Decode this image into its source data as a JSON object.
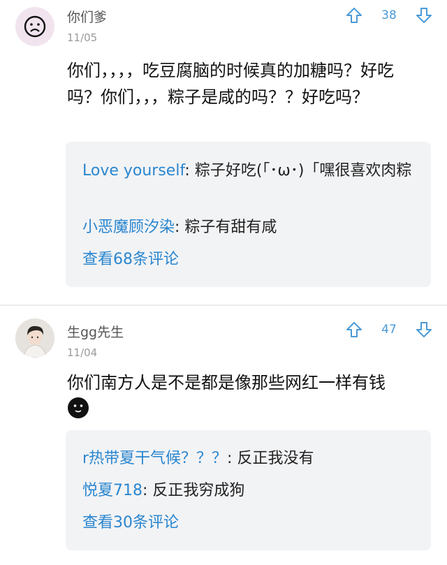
{
  "comments": [
    {
      "username": "你们爹",
      "date": "11/05",
      "votes": "38",
      "text": "你们，，，，吃豆腐脑的时候真的加糖吗？好吃吗？你们，，，粽子是咸的吗？？好吃吗？",
      "avatar_icon": "sad-face-icon",
      "replies": [
        {
          "name": "Love yourself",
          "sep": ": ",
          "text": "粽子好吃(「･ω･)「嘿很喜欢肉粽"
        },
        {
          "name": "小恶魔顾汐染",
          "sep": ": ",
          "text": "粽子有甜有咸"
        }
      ],
      "view_more": "查看68条评论"
    },
    {
      "username": "生gg先生",
      "date": "11/04",
      "votes": "47",
      "text": "你们南方人是不是都是像那些网红一样有钱",
      "avatar_icon": "user-photo-icon",
      "emoji_icon": "black-face-emoji-icon",
      "replies": [
        {
          "name": "r热带夏干气候？？？",
          "sep": ": ",
          "text": "反正我没有"
        },
        {
          "name": "悦夏718",
          "sep": ": ",
          "text": "反正我穷成狗"
        }
      ],
      "view_more": "查看30条评论"
    }
  ],
  "colors": {
    "accent": "#2a86cf",
    "vote": "#4a9ad6",
    "reply_bg": "#f2f3f5"
  }
}
